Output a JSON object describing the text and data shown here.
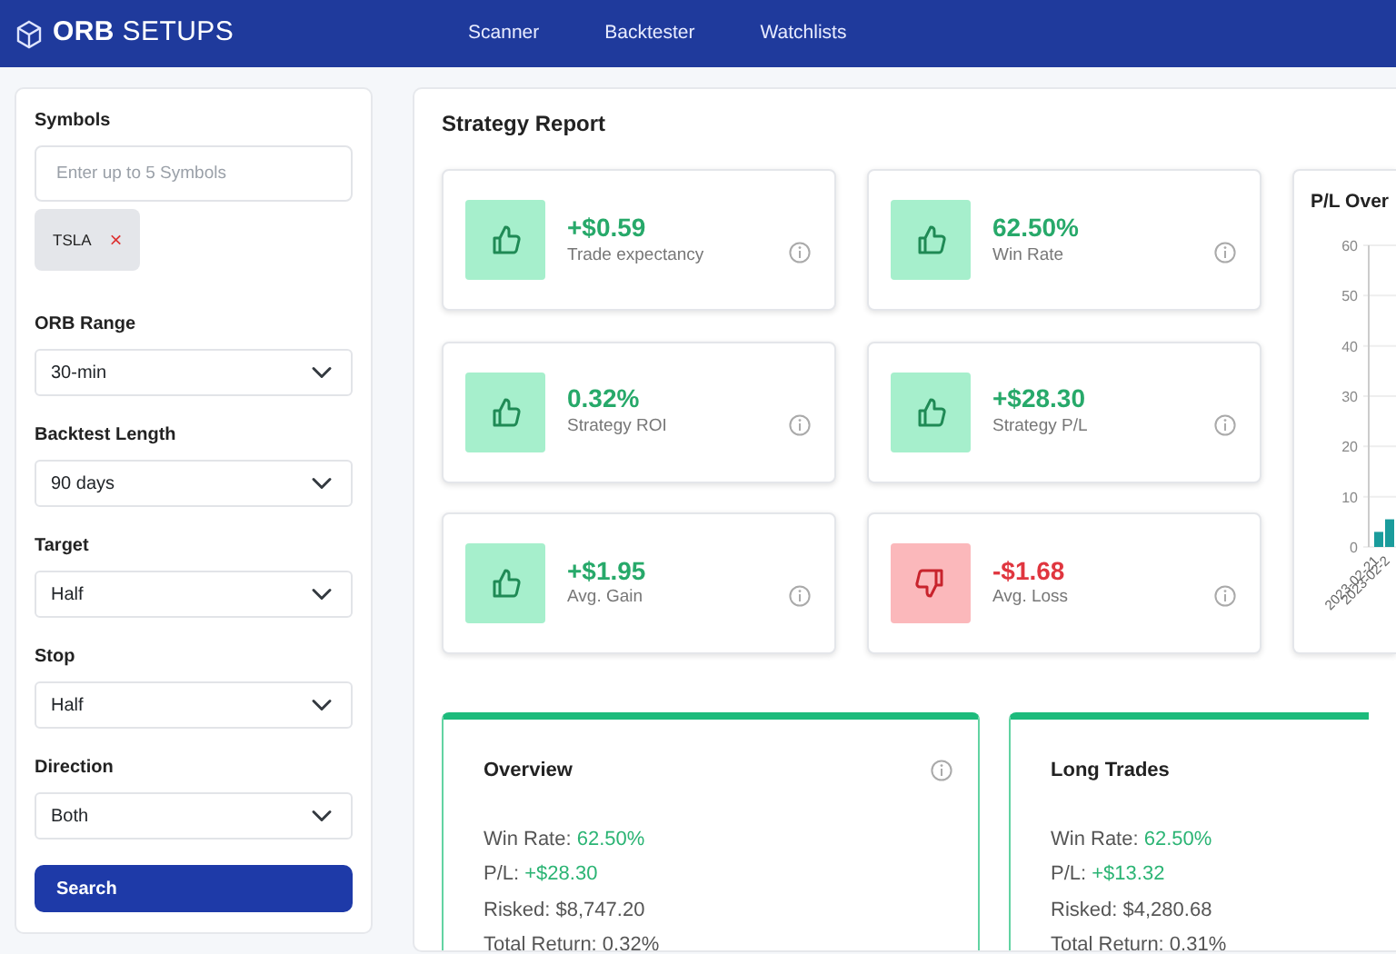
{
  "navbar": {
    "brand": "**ORB** SETUPS",
    "links": [
      {
        "label": "Scanner"
      },
      {
        "label": "Backtester"
      },
      {
        "label": "Watchlists"
      }
    ]
  },
  "sidebar": {
    "symbols_label": "Symbols",
    "symbols_placeholder": "Enter up to 5 Symbols",
    "chips": [
      {
        "label": "TSLA",
        "remove": "×"
      }
    ],
    "selects": [
      {
        "label": "ORB Range",
        "value": "30-min"
      },
      {
        "label": "Backtest Length",
        "value": "90 days"
      },
      {
        "label": "Target",
        "value": "Half"
      },
      {
        "label": "Stop",
        "value": "Half"
      },
      {
        "label": "Direction",
        "value": "Both"
      }
    ],
    "button": "Search"
  },
  "report": {
    "title": "Strategy Report",
    "stats": [
      {
        "value": "+$0.59",
        "label": "Trade expectancy",
        "kind": "positive"
      },
      {
        "value": "62.50%",
        "label": "Win Rate",
        "kind": "positive"
      },
      {
        "value": "0.32%",
        "label": "Strategy ROI",
        "kind": "positive"
      },
      {
        "value": "+$28.30",
        "label": "Strategy P/L",
        "kind": "positive"
      },
      {
        "value": "+$1.95",
        "label": "Avg. Gain",
        "kind": "positive"
      },
      {
        "value": "-$1.68",
        "label": "Avg. Loss",
        "kind": "negative"
      }
    ],
    "chart": {
      "title": "P/L Over",
      "chart_data": {
        "type": "bar",
        "categories": [
          "2023-02-21",
          "2023-02-2"
        ],
        "series": [
          {
            "color": "#1a9c9c",
            "values": [
              3,
              5.5
            ]
          }
        ],
        "grid": true,
        "ylim": [
          0,
          60
        ],
        "yticks": [
          0,
          10,
          20,
          30,
          40,
          50,
          60
        ]
      }
    },
    "summaries": [
      {
        "title": "Overview",
        "info": true,
        "lines": [
          {
            "label": "Win Rate:",
            "value": "62.50%",
            "positive": true
          },
          {
            "label": "P/L:",
            "value": "+$28.30",
            "positive": true
          },
          {
            "label": "Risked:",
            "value": "$8,747.20",
            "positive": false
          },
          {
            "label": "Total Return:",
            "value": "0.32%",
            "positive": false
          }
        ]
      },
      {
        "title": "Long Trades",
        "info": false,
        "lines": [
          {
            "label": "Win Rate:",
            "value": "62.50%",
            "positive": true
          },
          {
            "label": "P/L:",
            "value": "+$13.32",
            "positive": true
          },
          {
            "label": "Risked:",
            "value": "$4,280.68",
            "positive": false
          },
          {
            "label": "Total Return:",
            "value": "0.31%",
            "positive": false
          }
        ]
      }
    ]
  }
}
